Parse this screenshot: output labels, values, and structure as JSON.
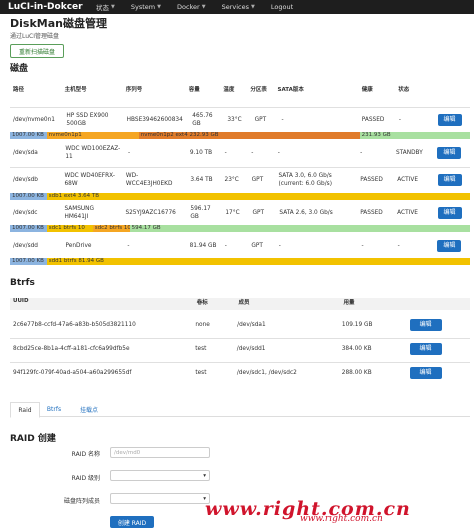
{
  "topbar": {
    "brand": "LuCI-in-Dokcer",
    "menu": [
      {
        "label": "状态"
      },
      {
        "label": "System"
      },
      {
        "label": "Docker"
      },
      {
        "label": "Services"
      },
      {
        "label": "Logout"
      }
    ]
  },
  "page": {
    "title": "DiskMan磁盘管理",
    "subtitle": "通过LuCI管理磁盘",
    "rescan_label": "重新扫描磁盘"
  },
  "disks": {
    "heading": "磁盘",
    "columns": [
      "路径",
      "主机型号",
      "序列号",
      "容量",
      "温度",
      "分区表",
      "SATA版本",
      "健康",
      "状态",
      ""
    ],
    "edit_label": "编辑",
    "rows": [
      {
        "path": "/dev/nvme0n1",
        "model": "HP SSD EX900 500GB",
        "serial": "HBSE39462600834",
        "size": "465.76 GB",
        "temp": "33°C",
        "ptable": "GPT",
        "sata": "-",
        "health": "PASSED",
        "status": "-"
      },
      {
        "path": "/dev/sda",
        "model": "WDC WD100EZAZ-11",
        "serial": "-",
        "size": "9.10 TB",
        "temp": "-",
        "ptable": "-",
        "sata": "-",
        "health": "-",
        "status": "STANDBY"
      },
      {
        "path": "/dev/sdb",
        "model": "WDC WD40EFRX-68W",
        "serial": "WD-WCC4E3JH0EKD",
        "size": "3.64 TB",
        "temp": "23°C",
        "ptable": "GPT",
        "sata": "SATA 3.0, 6.0 Gb/s (current: 6.0 Gb/s)",
        "health": "PASSED",
        "status": "ACTIVE"
      },
      {
        "path": "/dev/sdc",
        "model": "SAMSUNG HM641JI",
        "serial": "S25YJ9AZC16776",
        "size": "596.17 GB",
        "temp": "17°C",
        "ptable": "GPT",
        "sata": "SATA 2.6, 3.0 Gb/s",
        "health": "PASSED",
        "status": "ACTIVE"
      },
      {
        "path": "/dev/sdd",
        "model": "PenDrive",
        "serial": "-",
        "size": "81.94 GB",
        "temp": "-",
        "ptable": "GPT",
        "sata": "-",
        "health": "-",
        "status": "-"
      }
    ],
    "bars": [
      {
        "segments": [
          {
            "text": "1007.00 KB",
            "color": "#8cb4e0",
            "start": 0,
            "end": 0.08
          },
          {
            "text": "nvme0n1p1",
            "color": "#f5a623",
            "start": 0.08,
            "end": 0.28
          },
          {
            "text": "nvme0n1p2 ext4 232.93 GB",
            "color": "#e07b2a",
            "start": 0.28,
            "end": 0.76
          },
          {
            "text": "231.93 GB",
            "color": "#a8e0a0",
            "start": 0.76,
            "end": 1.0
          }
        ]
      },
      {
        "segments": [
          {
            "text": "1007.00 KB",
            "color": "#8cb4e0",
            "start": 0,
            "end": 0.08
          },
          {
            "text": "sdb1 ext4 3.64 TB",
            "color": "#f2c200",
            "start": 0.08,
            "end": 1.0
          }
        ]
      },
      {
        "segments": [
          {
            "text": "1007.00 KB",
            "color": "#8cb4e0",
            "start": 0,
            "end": 0.08
          },
          {
            "text": "sdc1 btrfs 10",
            "color": "#f2c200",
            "start": 0.08,
            "end": 0.18
          },
          {
            "text": "sdc2 btrfs 10",
            "color": "#f5a623",
            "start": 0.18,
            "end": 0.26
          },
          {
            "text": "594.17 GB",
            "color": "#a8e0a0",
            "start": 0.26,
            "end": 1.0
          }
        ]
      },
      {
        "segments": [
          {
            "text": "1007.00 KB",
            "color": "#8cb4e0",
            "start": 0,
            "end": 0.08
          },
          {
            "text": "sdd1 btrfs 81.94 GB",
            "color": "#f2c200",
            "start": 0.08,
            "end": 1.0
          }
        ]
      }
    ]
  },
  "btrfs": {
    "heading": "Btrfs",
    "columns": [
      "UUID",
      "卷标",
      "成员",
      "用量",
      ""
    ],
    "edit_label": "编辑",
    "rows": [
      {
        "uuid": "2c6e77b8-ccfd-47a6-a83b-b505d3821110",
        "label": "none",
        "members": "/dev/sda1",
        "usage": "109.19 GB"
      },
      {
        "uuid": "8cbd25ce-8b1a-4cff-a181-cfc6a99dfb5e",
        "label": "test",
        "members": "/dev/sdd1",
        "usage": "384.00 KB"
      },
      {
        "uuid": "94f129fc-079f-40ad-a504-a60a299655df",
        "label": "test",
        "members": "/dev/sdc1, /dev/sdc2",
        "usage": "288.00 KB"
      }
    ]
  },
  "tabs": [
    {
      "label": "Raid"
    },
    {
      "label": "Btrfs"
    },
    {
      "label": "挂载点"
    }
  ],
  "raid": {
    "heading": "RAID 创建",
    "name_label": "RAID 名称",
    "name_placeholder": "/dev/md0",
    "level_label": "RAID 级别",
    "members_label": "磁盘阵列成员",
    "create_label": "创建 RAID"
  },
  "watermark": {
    "text": "www.right.com.cn",
    "small": "www.right.com.cn"
  }
}
